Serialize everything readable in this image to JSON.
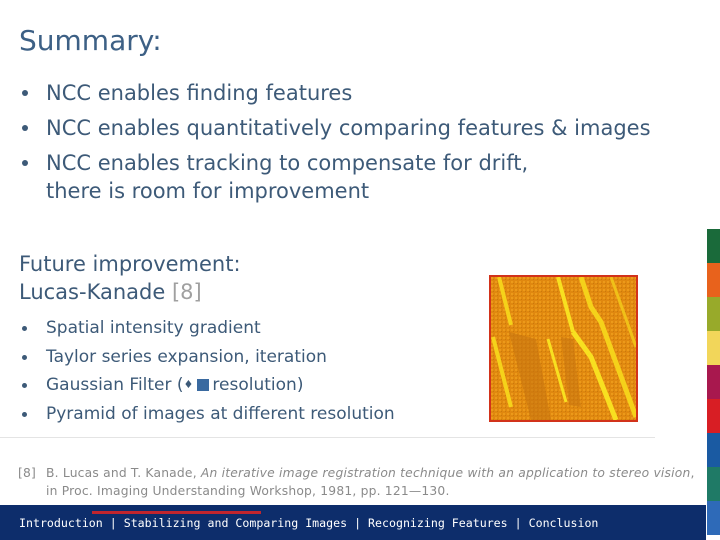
{
  "slide": {
    "title": "Summary:",
    "summary_bullets": [
      "NCC enables finding features",
      "NCC enables quantitatively comparing features & images",
      "NCC enables tracking to compensate for drift,",
      "there is room for improvement"
    ],
    "future_heading": "Future improvement:",
    "method_name": "Lucas-Kanade",
    "method_ref": "[8]",
    "method_bullets": [
      "Spatial intensity gradient",
      "Taylor series expansion, iteration",
      "Gaussian Filter (",
      "resolution)",
      "Pyramid of images at different resolution"
    ],
    "gaussian_symbols": {
      "diamond": "♦"
    },
    "image_description": "AFM scan image with diagonal yellow step edges on orange surface"
  },
  "footnote": {
    "label": "[8]",
    "authors": "B. Lucas and T. Kanade, ",
    "title": "An iterative image registration technique with an application to stereo vision",
    "rest1": ",",
    "rest2": "in Proc. Imaging Understanding Workshop, 1981, pp. 121—130."
  },
  "footer": {
    "nav": [
      {
        "label": "Introduction",
        "active": false
      },
      {
        "label": "Stabilizing and Comparing Images",
        "active": true
      },
      {
        "label": "Recognizing Features",
        "active": false
      },
      {
        "label": "Conclusion",
        "active": false
      }
    ],
    "separator": " | "
  },
  "colors": {
    "title": "#3d6085",
    "text": "#3d5a78",
    "footer_bg": "#0d2d6b",
    "active_indicator": "#c1252d",
    "strip": [
      "#1a6a3a",
      "#e8621c",
      "#98aa2a",
      "#f2d65a",
      "#a8184e",
      "#d81e24",
      "#1a5aa2",
      "#1f7a66",
      "#2e6ab8"
    ]
  }
}
